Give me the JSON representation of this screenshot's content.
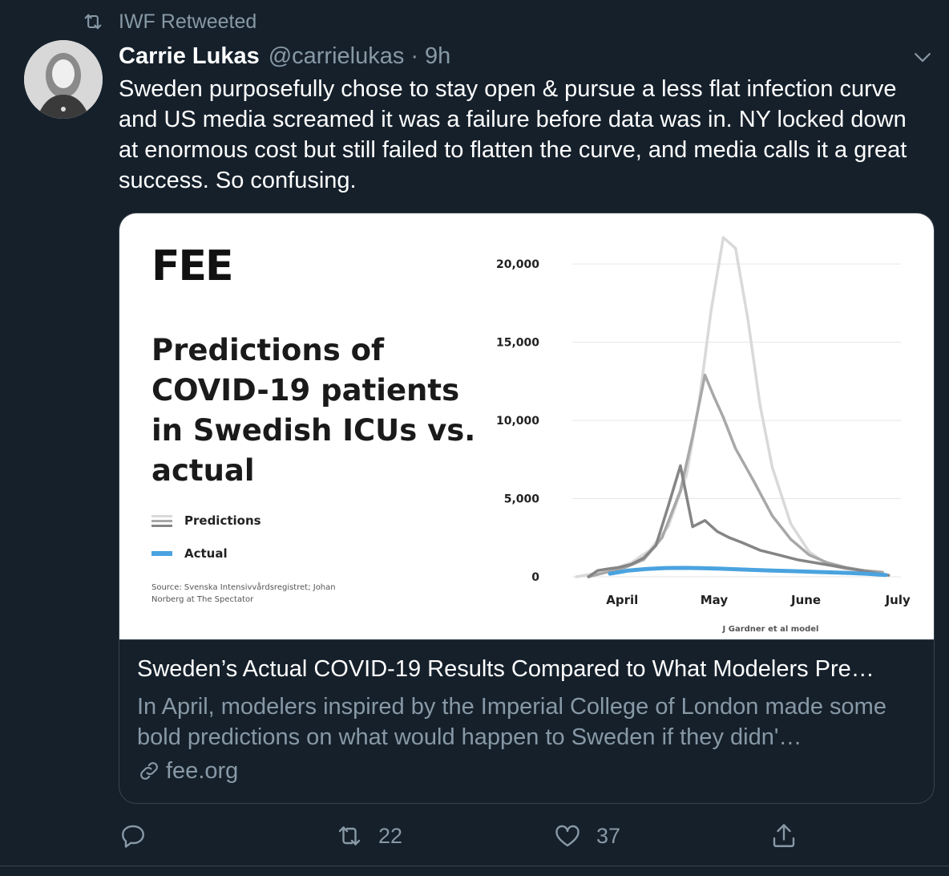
{
  "social_context": {
    "text": "IWF Retweeted"
  },
  "tweet": {
    "author_name": "Carrie Lukas",
    "handle": "@carrielukas",
    "separator": "·",
    "time": "9h",
    "text": "Sweden purposefully chose to stay open & pursue a less flat infection curve and US media screamed it was a failure before data was in. NY locked down at enormous cost but still failed to flatten the curve, and media calls it a great success. So confusing."
  },
  "card": {
    "image": {
      "logo": "FEE",
      "headline": "Predictions of COVID-19 patients in Swedish ICUs vs. actual",
      "legend": [
        {
          "label": "Predictions",
          "color": "#cfcfcf"
        },
        {
          "label": "Actual",
          "color": "#4aa3df"
        }
      ],
      "source": "Source: Svenska Intensivvårdsregistret; Johan Norberg at The Spectator"
    },
    "title": "Sweden’s Actual COVID-19 Results Compared to What Modelers Pre…",
    "description": "In April, modelers inspired by the Imperial College of London made some bold predictions on what would happen to Sweden if they didn'…",
    "domain": "fee.org"
  },
  "chart_data": {
    "type": "line",
    "title": "Predictions of COVID-19 patients in Swedish ICUs vs. actual",
    "xlabel": "J Gardner et al model",
    "ylabel": "",
    "x_tick_labels": [
      "April",
      "May",
      "June",
      "July"
    ],
    "x_tick_positions": [
      1,
      31,
      61,
      91
    ],
    "y_ticks": [
      0,
      5000,
      10000,
      15000,
      20000
    ],
    "y_tick_labels": [
      "0",
      "5,000",
      "10,000",
      "15,000",
      "20,000"
    ],
    "ylim": [
      0,
      21700
    ],
    "xlim": [
      -14,
      92
    ],
    "grid": true,
    "series": [
      {
        "name": "Predictions",
        "role": "prediction-high",
        "color": "#d9d9d9",
        "x": [
          -14,
          -8,
          -2,
          4,
          10,
          16,
          22,
          26,
          30,
          34,
          38,
          42,
          46,
          50,
          56,
          62,
          68,
          74,
          80,
          86
        ],
        "y": [
          0,
          200,
          500,
          900,
          1700,
          3200,
          6500,
          11000,
          17000,
          21700,
          21000,
          16500,
          11000,
          7000,
          3400,
          1600,
          800,
          500,
          400,
          300
        ]
      },
      {
        "name": "Predictions",
        "role": "prediction-mid",
        "color": "#a8a8a8",
        "x": [
          -10,
          -4,
          2,
          8,
          14,
          20,
          24,
          28,
          31,
          34,
          38,
          44,
          50,
          56,
          62,
          68,
          74,
          80,
          86
        ],
        "y": [
          0,
          300,
          600,
          1100,
          2500,
          5500,
          9000,
          12900,
          11500,
          10200,
          8200,
          6100,
          3900,
          2400,
          1400,
          900,
          600,
          400,
          300
        ]
      },
      {
        "name": "Predictions",
        "role": "prediction-low",
        "color": "#858585",
        "x": [
          -10,
          -7,
          -4,
          0,
          4,
          8,
          12,
          16,
          20,
          24,
          28,
          32,
          36,
          40,
          46,
          52,
          58,
          64,
          70,
          76,
          82,
          88
        ],
        "y": [
          0,
          400,
          500,
          600,
          800,
          1200,
          2000,
          4500,
          7100,
          3200,
          3600,
          2900,
          2500,
          2200,
          1700,
          1400,
          1100,
          900,
          700,
          500,
          300,
          100
        ]
      },
      {
        "name": "Actual",
        "role": "actual",
        "color": "#4aa3df",
        "x": [
          -3,
          3,
          9,
          15,
          21,
          27,
          33,
          39,
          45,
          51,
          57,
          63,
          69,
          75,
          81,
          87
        ],
        "y": [
          200,
          400,
          500,
          560,
          570,
          550,
          520,
          470,
          430,
          390,
          360,
          320,
          280,
          240,
          190,
          120
        ]
      }
    ]
  },
  "actions": {
    "reply_count": "",
    "retweet_count": "22",
    "like_count": "37"
  }
}
